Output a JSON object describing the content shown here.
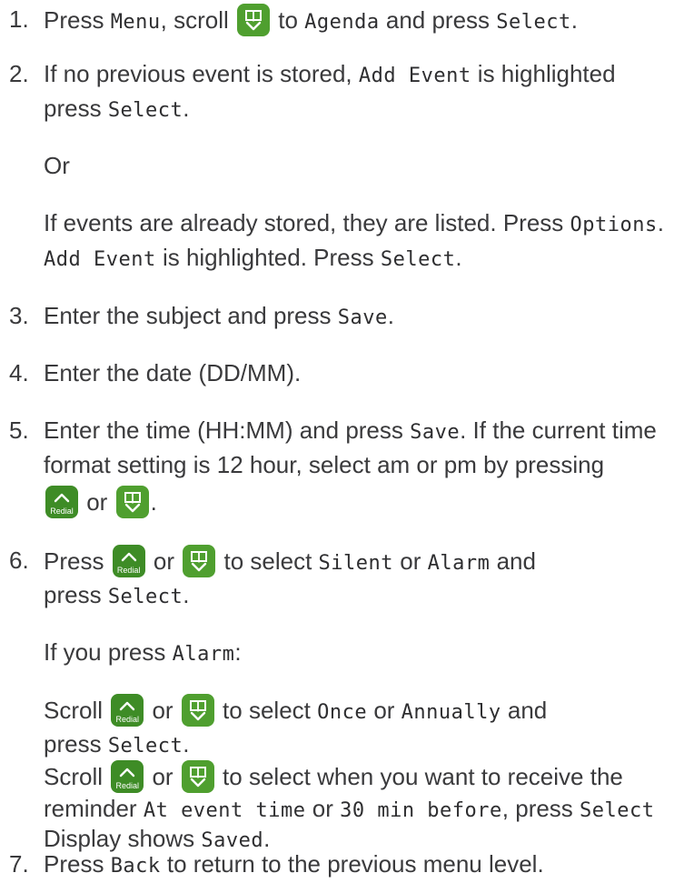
{
  "colors": {
    "text": "#3a3a3c",
    "icon_green": "#4f9f2f"
  },
  "icons": {
    "down": "down-phonebook-icon",
    "redial": "redial-up-icon",
    "redial_label": "Redial"
  },
  "steps": [
    {
      "num": "1.",
      "t1": "Press ",
      "k1": "Menu",
      "t2": ", scroll ",
      "t3": " to ",
      "k2": "Agenda",
      "t4": " and press ",
      "k3": "Select",
      "t5": "."
    },
    {
      "num": "2.",
      "t1": "If no previous event is stored, ",
      "k1": "Add Event",
      "t2": " is highlighted",
      "t3": "press ",
      "k2": "Select",
      "t4": "."
    },
    {
      "num": "3.",
      "t1": "Enter the subject and press ",
      "k1": "Save",
      "t2": "."
    },
    {
      "num": "4.",
      "t1": "Enter the date (DD/MM)."
    },
    {
      "num": "5.",
      "t1": "Enter the time (HH:MM) and press ",
      "k1": "Save",
      "t2": ". If the current time",
      "t3": "format setting is 12 hour, select am or pm by pressing",
      "t4": " or ",
      "t5": "."
    },
    {
      "num": "6.",
      "t1": "Press ",
      "t2": " or ",
      "t3": " to select ",
      "k1": "Silent",
      "t4": " or ",
      "k2": "Alarm",
      "t5": " and",
      "t6": "press ",
      "k3": "Select",
      "t7": "."
    },
    {
      "num": "7.",
      "t1": "Press ",
      "k1": "Back",
      "t2": " to return to the previous menu level."
    }
  ],
  "notes": {
    "or": "Or",
    "existing_a": "If events are already stored, they are listed. Press ",
    "existing_k1": "Options",
    "existing_b": ".",
    "existing_k2": "Add Event",
    "existing_c": " is highlighted. Press ",
    "existing_k3": "Select",
    "existing_d": ".",
    "alarm_a": "If you press ",
    "alarm_k": "Alarm",
    "alarm_b": ":",
    "scroll1_a": "Scroll ",
    "scroll1_b": " or ",
    "scroll1_c": " to select ",
    "scroll1_k1": "Once",
    "scroll1_d": " or ",
    "scroll1_k2": "Annually",
    "scroll1_e": " and",
    "scroll1_f": "press ",
    "scroll1_k3": "Select",
    "scroll1_g": ".",
    "scroll2_a": "Scroll ",
    "scroll2_b": " or ",
    "scroll2_c": " to select when you want to receive the",
    "scroll2_d": "reminder ",
    "scroll2_k1": "At event time",
    "scroll2_e": " or ",
    "scroll2_k2": "30 min before",
    "scroll2_f": ", press ",
    "scroll2_k3": "Select",
    "saved_a": "Display shows ",
    "saved_k": "Saved",
    "saved_b": "."
  }
}
